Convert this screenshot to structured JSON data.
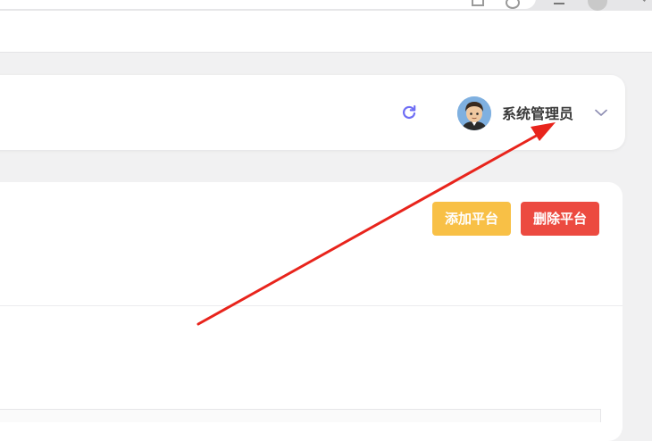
{
  "header": {
    "user_name": "系统管理员",
    "refresh_icon": "refresh-icon",
    "dropdown_icon": "chevron-down-icon",
    "avatar": "user-avatar"
  },
  "toolbar": {
    "add_platform_label": "添加平台",
    "delete_platform_label": "删除平台"
  },
  "colors": {
    "accent": "#6f6ef5",
    "add_button": "#f8c046",
    "delete_button": "#ec4a40",
    "annotation_arrow": "#e8241c"
  }
}
